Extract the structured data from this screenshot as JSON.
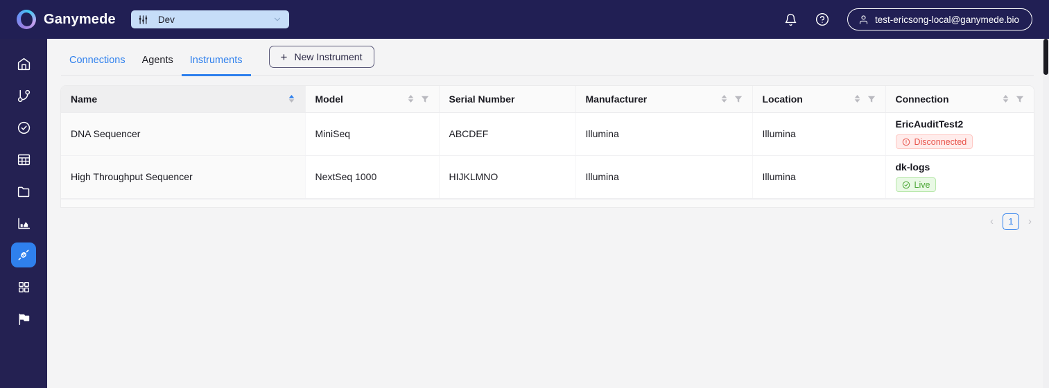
{
  "topbar": {
    "brand_name": "Ganymede",
    "env_selector": {
      "value": "Dev",
      "icon": "sliders-icon",
      "chevron": "chevron-down-icon"
    },
    "bell_icon": "bell-icon",
    "help_icon": "help-circle-icon",
    "user": {
      "avatar_icon": "user-icon",
      "email": "test-ericsong-local@ganymede.bio"
    }
  },
  "sidebar": {
    "items": [
      {
        "name": "home",
        "icon": "home-icon",
        "active": false
      },
      {
        "name": "flows",
        "icon": "git-branch-icon",
        "active": false
      },
      {
        "name": "runs",
        "icon": "check-circle-icon",
        "active": false
      },
      {
        "name": "tables",
        "icon": "table-grid-icon",
        "active": false
      },
      {
        "name": "files",
        "icon": "folder-icon",
        "active": false
      },
      {
        "name": "analytics",
        "icon": "bar-chart-icon",
        "active": false
      },
      {
        "name": "connections",
        "icon": "plug-icon",
        "active": true
      },
      {
        "name": "apps",
        "icon": "apps-grid-icon",
        "active": false
      },
      {
        "name": "flags",
        "icon": "flag-icon",
        "active": false
      }
    ]
  },
  "tabs": [
    {
      "label": "Connections",
      "state": "link"
    },
    {
      "label": "Agents",
      "state": "dark"
    },
    {
      "label": "Instruments",
      "state": "active"
    }
  ],
  "new_instrument_button": {
    "label": "New Instrument",
    "icon": "plus-icon"
  },
  "table": {
    "columns": [
      {
        "label": "Name",
        "sorted": true,
        "sort_direction": "asc",
        "filterable": false
      },
      {
        "label": "Model",
        "sorted": false,
        "filterable": true
      },
      {
        "label": "Serial Number",
        "sorted": false,
        "filterable": false
      },
      {
        "label": "Manufacturer",
        "sorted": false,
        "filterable": true
      },
      {
        "label": "Location",
        "sorted": false,
        "filterable": true
      },
      {
        "label": "Connection",
        "sorted": false,
        "filterable": true
      }
    ],
    "rows": [
      {
        "name": "DNA Sequencer",
        "model": "MiniSeq",
        "serial_number": "ABCDEF",
        "manufacturer": "Illumina",
        "location": "Illumina",
        "connection_name": "EricAuditTest2",
        "status_label": "Disconnected",
        "status_kind": "red",
        "status_icon": "alert-circle-icon"
      },
      {
        "name": "High Throughput Sequencer",
        "model": "NextSeq 1000",
        "serial_number": "HIJKLMNO",
        "manufacturer": "Illumina",
        "location": "Illumina",
        "connection_name": "dk-logs",
        "status_label": "Live",
        "status_kind": "green",
        "status_icon": "check-circle-icon"
      }
    ]
  },
  "pagination": {
    "prev": "‹",
    "page": "1",
    "next": "›"
  },
  "colors": {
    "navy": "#211f54",
    "accent_blue": "#2f80ed",
    "env_pill": "#c6ddf8",
    "page_bg": "#f4f4f5",
    "status_red": "#e8534a",
    "status_green": "#4aa635"
  }
}
